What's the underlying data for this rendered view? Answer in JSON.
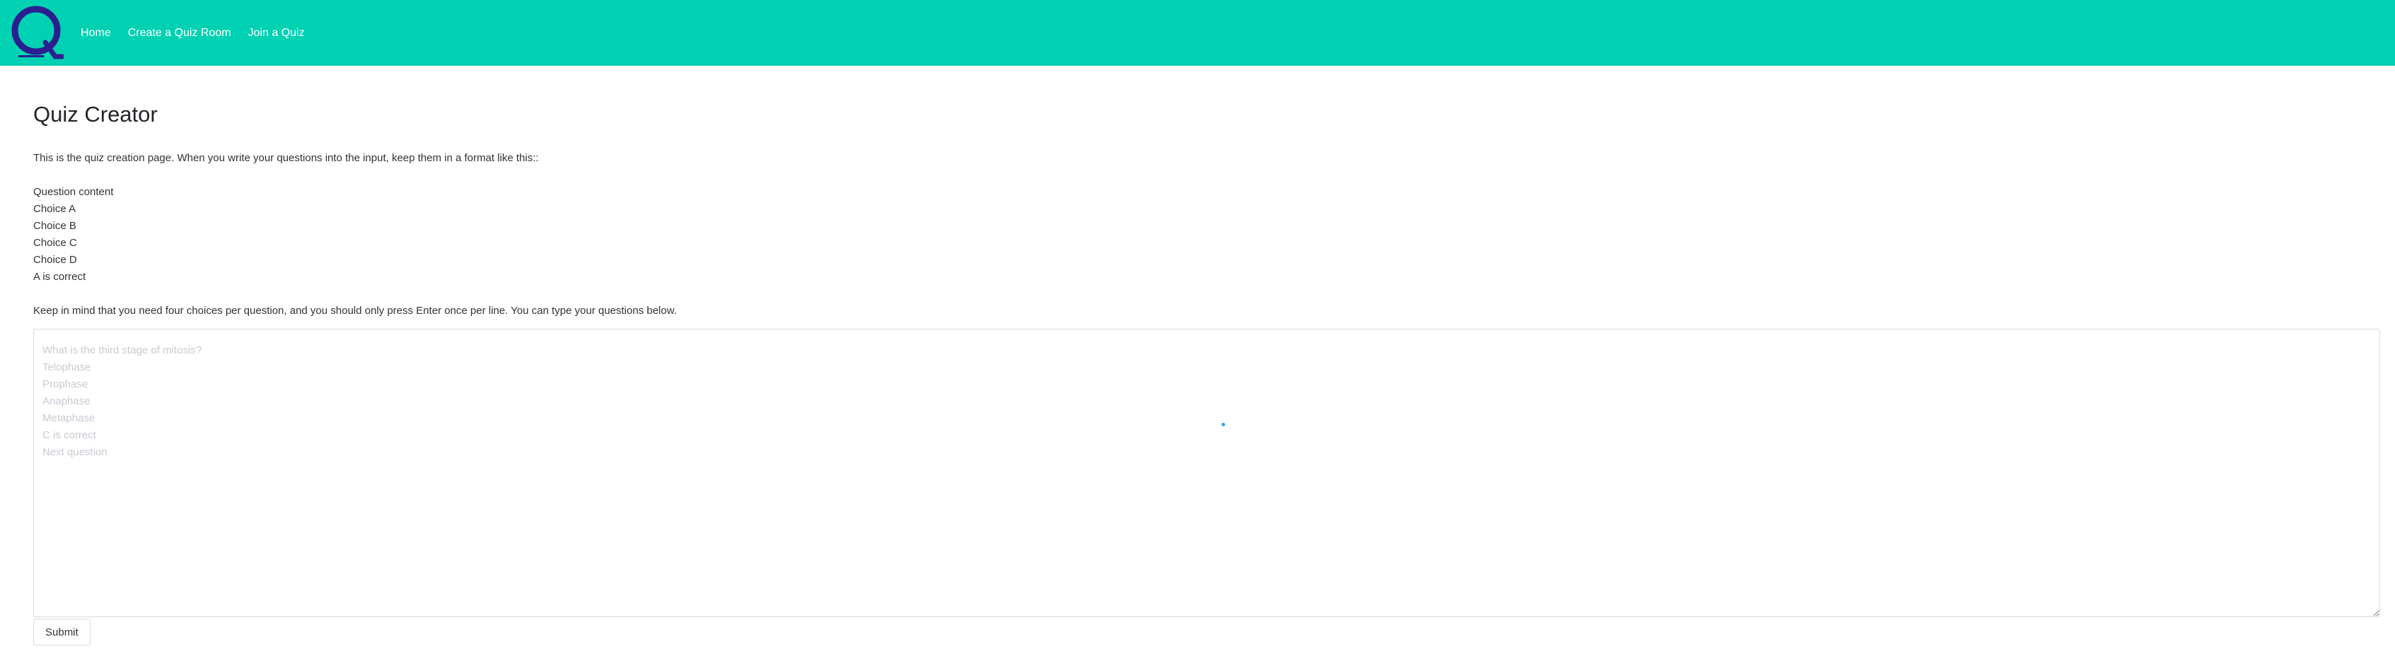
{
  "navbar": {
    "logo_icon": "quiz-logo-q",
    "background_color": "#00d1b2",
    "links": [
      {
        "label": "Home"
      },
      {
        "label": "Create a Quiz Room"
      },
      {
        "label": "Join a Quiz"
      }
    ]
  },
  "main": {
    "title": "Quiz Creator",
    "intro": "This is the quiz creation page. When you write your questions into the input, keep them in a format like this::",
    "format_lines": [
      "Question content",
      "Choice A",
      "Choice B",
      "Choice C",
      "Choice D",
      "A is correct"
    ],
    "note": "Keep in mind that you need four choices per question, and you should only press Enter once per line. You can type your questions below.",
    "textarea": {
      "value": "",
      "placeholder": "What is the third stage of mitosis?\nTelophase\nProphase\nAnaphase\nMetaphase\nC is correct\nNext question"
    },
    "submit_label": "Submit"
  }
}
